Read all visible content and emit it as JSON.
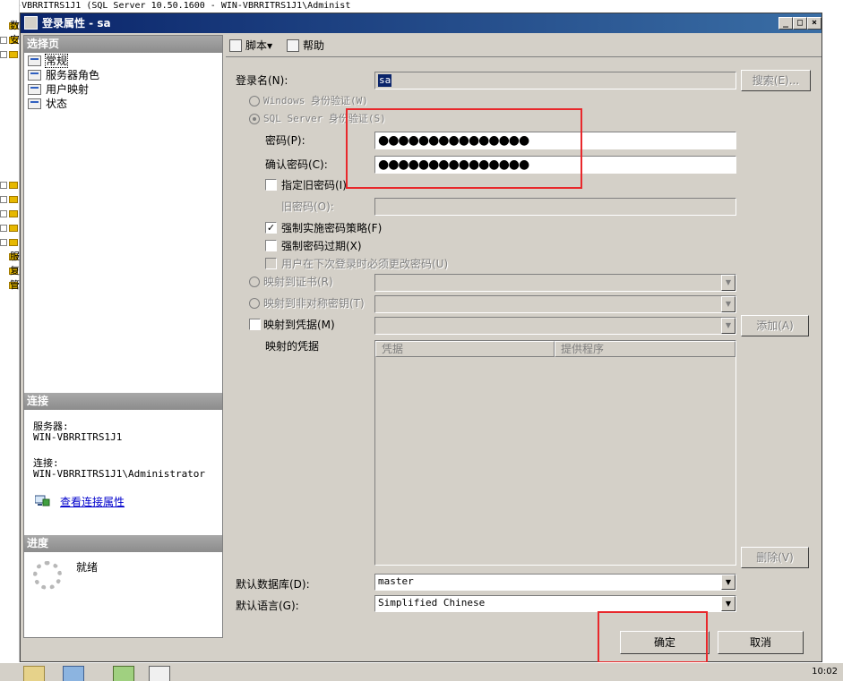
{
  "background": {
    "topline": "WIN-VBRRITRS1J1 (SQL Server 10.50.1600 - WIN-VBRRITRS1J1\\Administ",
    "tree_labels": [
      "数",
      "安",
      "服",
      "复",
      "管",
      "SQ"
    ]
  },
  "dialog": {
    "title": "登录属性 - sa",
    "window_buttons": {
      "minimize": "_",
      "maximize": "□",
      "close": "×"
    }
  },
  "left_pane": {
    "select_page_header": "选择页",
    "pages": [
      "常规",
      "服务器角色",
      "用户映射",
      "状态"
    ],
    "connection_header": "连接",
    "server_label": "服务器:",
    "server_value": "WIN-VBRRITRS1J1",
    "connection_label": "连接:",
    "connection_value": "WIN-VBRRITRS1J1\\Administrator",
    "view_connection_link": "查看连接属性",
    "progress_header": "进度",
    "progress_status": "就绪"
  },
  "toolbar": {
    "script_label": "脚本",
    "help_label": "帮助"
  },
  "form": {
    "login_name_label": "登录名(N):",
    "login_name_value": "sa",
    "search_button": "搜索(E)...",
    "windows_auth_label": "Windows 身份验证(W)",
    "sql_auth_label": "SQL Server 身份验证(S)",
    "password_label": "密码(P):",
    "password_value": "●●●●●●●●●●●●●●●",
    "confirm_password_label": "确认密码(C):",
    "confirm_password_value": "●●●●●●●●●●●●●●●",
    "specify_old_password_label": "指定旧密码(I)",
    "old_password_label": "旧密码(O):",
    "enforce_policy_label": "强制实施密码策略(F)",
    "enforce_expiration_label": "强制密码过期(X)",
    "must_change_label": "用户在下次登录时必须更改密码(U)",
    "map_certificate_label": "映射到证书(R)",
    "map_asymmetric_label": "映射到非对称密钥(T)",
    "map_credential_label": "映射到凭据(M)",
    "add_button": "添加(A)",
    "mapped_credentials_label": "映射的凭据",
    "grid_headers": [
      "凭据",
      "提供程序"
    ],
    "remove_button": "删除(V)",
    "default_db_label": "默认数据库(D):",
    "default_db_value": "master",
    "default_lang_label": "默认语言(G):",
    "default_lang_value": "Simplified Chinese"
  },
  "footer": {
    "ok_button": "确定",
    "cancel_button": "取消"
  },
  "taskbar": {
    "clock": "10:02"
  },
  "colors": {
    "title_start": "#0a246a",
    "title_end": "#3a6ea5",
    "dialog_bg": "#d4d0c8",
    "highlight_red": "#e8282c",
    "link": "#0000cc"
  }
}
